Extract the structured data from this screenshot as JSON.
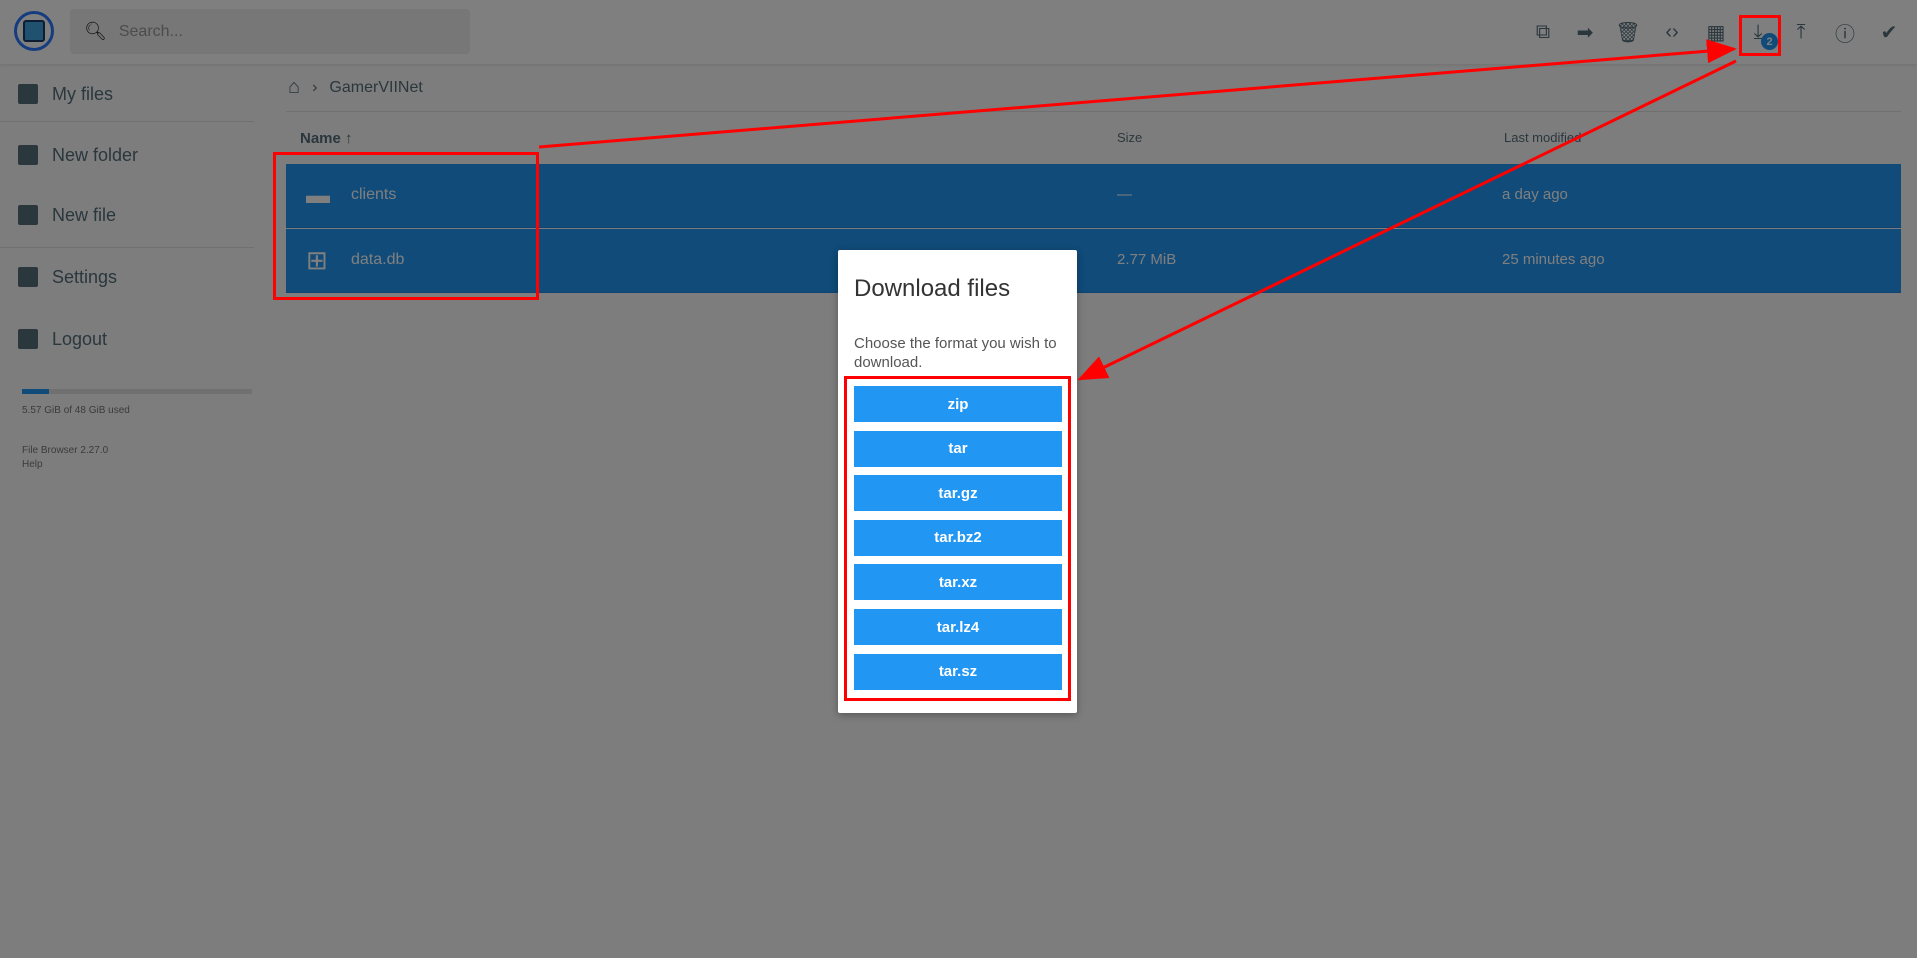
{
  "header": {
    "search_placeholder": "Search...",
    "download_badge": "2",
    "toolbar": [
      "copy-icon",
      "move-icon",
      "delete-icon",
      "code-icon",
      "grid-view-icon",
      "download-icon",
      "upload-icon",
      "info-icon",
      "select-icon"
    ]
  },
  "sidebar": {
    "items": [
      {
        "label": "My files"
      },
      {
        "label": "New folder"
      },
      {
        "label": "New file"
      },
      {
        "label": "Settings"
      },
      {
        "label": "Logout"
      }
    ],
    "storage_text": "5.57 GiB of 48 GiB used",
    "storage_fraction": 0.116,
    "version": "File Browser 2.27.0",
    "help": "Help"
  },
  "breadcrumb": {
    "current": "GamerVIINet"
  },
  "table": {
    "headers": {
      "name": "Name",
      "size": "Size",
      "modified": "Last modified"
    },
    "rows": [
      {
        "name": "clients",
        "size": "—",
        "modified": "a day ago"
      },
      {
        "name": "data.db",
        "size": "2.77 MiB",
        "modified": "25 minutes ago"
      }
    ]
  },
  "dialog": {
    "title": "Download files",
    "text": "Choose the format you wish to download.",
    "formats": [
      "zip",
      "tar",
      "tar.gz",
      "tar.bz2",
      "tar.xz",
      "tar.lz4",
      "tar.sz"
    ]
  },
  "colors": {
    "accent": "#2196f3",
    "annotation": "#ff0000"
  }
}
